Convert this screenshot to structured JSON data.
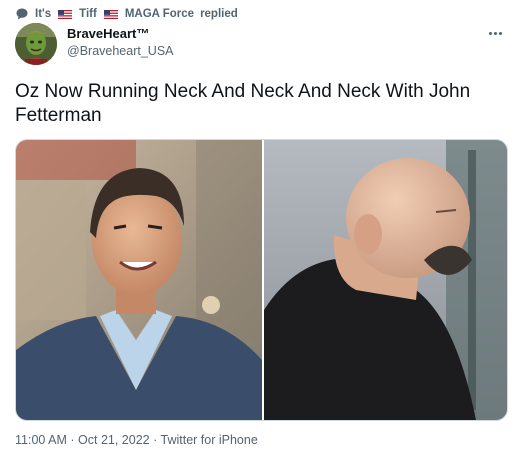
{
  "reply_context": {
    "prefix": "It's",
    "name_1": "Tiff",
    "name_2": "MAGA Force",
    "suffix": "replied",
    "icon": "speech-bubble-icon"
  },
  "author": {
    "display_name": "BraveHeart™",
    "handle": "@Braveheart_USA"
  },
  "tweet": {
    "text": "Oz Now Running Neck And Neck And Neck With John Fetterman"
  },
  "meta": {
    "time": "11:00 AM",
    "separator": "·",
    "date": "Oct 21, 2022",
    "source": "Twitter for iPhone"
  },
  "colors": {
    "text_primary": "#0f1419",
    "text_secondary": "#536471",
    "border": "#cfd9de"
  }
}
